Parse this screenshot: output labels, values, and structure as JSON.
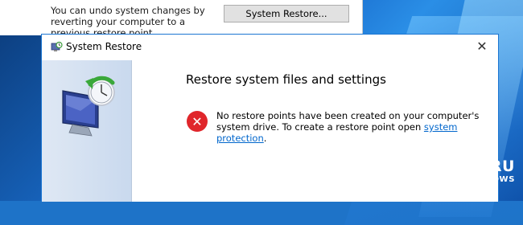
{
  "background_window": {
    "text": "You can undo system changes by reverting your computer to a previous restore point.",
    "button_label": "System Restore..."
  },
  "dialog": {
    "title": "System Restore",
    "heading": "Restore system files and settings",
    "message_prefix": "No restore points have been created on your computer's system drive. To create a restore point open ",
    "link_text": "system protection",
    "message_suffix": "."
  },
  "watermark": {
    "line1": "WINBLOG.RU",
    "line2": "ВСЁ О WINDOWS"
  },
  "icons": {
    "title": "system-restore-icon",
    "error": "error-icon",
    "close": "close-icon",
    "illustration": "restore-computer-icon"
  },
  "colors": {
    "accent": "#1c76d2",
    "error": "#e0262b",
    "link": "#0066cc"
  }
}
